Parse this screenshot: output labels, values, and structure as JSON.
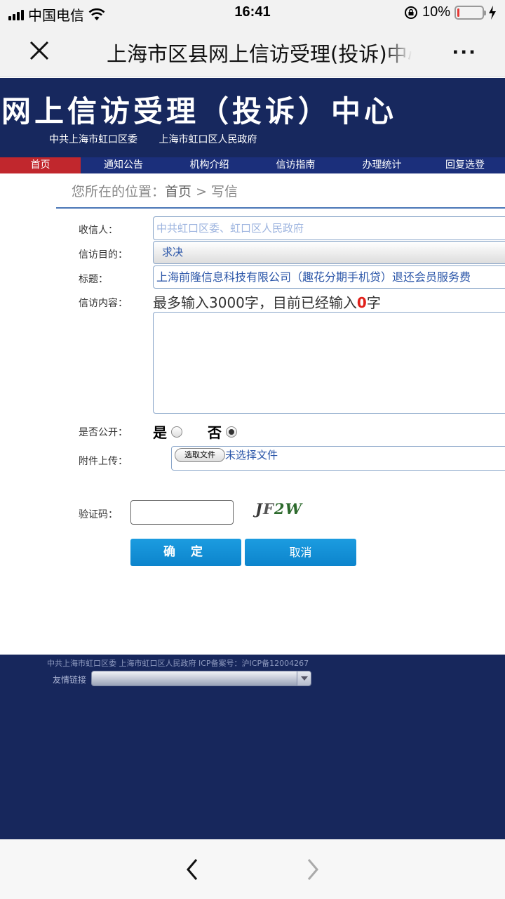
{
  "status_bar": {
    "carrier": "中国电信",
    "time": "16:41",
    "battery": "10%",
    "battery_level": 0.1
  },
  "navbar": {
    "title": "上海市区县网上信访受理(投诉)中心",
    "more": "···"
  },
  "banner": {
    "title": "网上信访受理（投诉）中心",
    "subtitles": [
      "中共上海市虹口区委",
      "上海市虹口区人民政府"
    ]
  },
  "menu": {
    "items": [
      {
        "label": "首页",
        "active": true
      },
      {
        "label": "通知公告",
        "active": false
      },
      {
        "label": "机构介绍",
        "active": false
      },
      {
        "label": "信访指南",
        "active": false
      },
      {
        "label": "办理统计",
        "active": false
      },
      {
        "label": "回复选登",
        "active": false
      }
    ]
  },
  "breadcrumb": {
    "prefix": "您所在的位置：",
    "home": "首页",
    "sep": " > ",
    "current": "写信"
  },
  "form": {
    "recipient_label": "收信人：",
    "recipient_placeholder": "中共虹口区委、虹口区人民政府",
    "purpose_label": "信访目的：",
    "purpose_value": "求决",
    "subject_label": "标题：",
    "subject_value": "上海前隆信息科技有限公司（趣花分期手机贷）退还会员服务费",
    "content_label": "信访内容：",
    "content_hint_prefix": "最多输入3000字，目前已经输入",
    "content_count": "0",
    "content_hint_suffix": "字",
    "public_label": "是否公开：",
    "public_yes": "是",
    "public_no": "否",
    "public_selected": "否",
    "attach_label": "附件上传：",
    "attach_button": "选取文件",
    "attach_status": "未选择文件",
    "captcha_label": "验证码：",
    "captcha_text": "JF2W",
    "confirm_label": "确 定",
    "cancel_label": "取消"
  },
  "footer": {
    "text": "中共上海市虹口区委 上海市虹口区人民政府 ICP备案号：沪ICP备12004267",
    "links_label": "友情链接"
  },
  "colors": {
    "banner_bg": "#17285e",
    "menu_bg": "#1b2f7b",
    "menu_active": "#c1272d",
    "button": "#0c84cc",
    "count_red": "#e1201a"
  }
}
